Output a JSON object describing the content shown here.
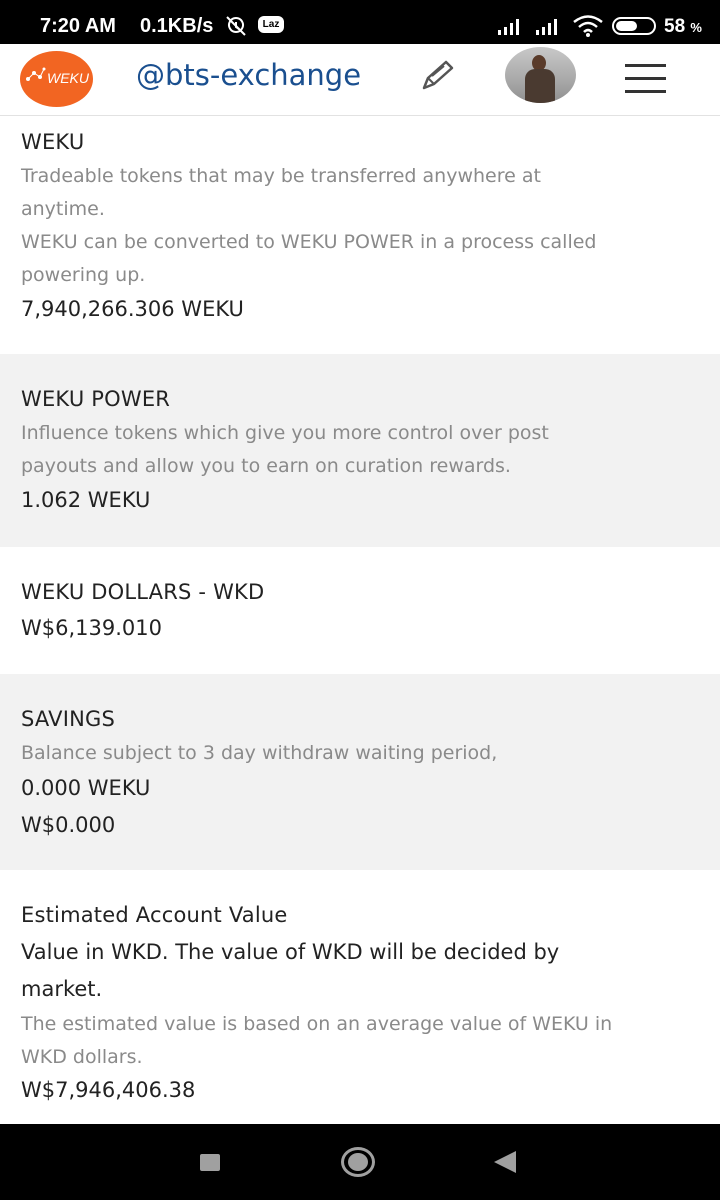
{
  "statusbar": {
    "time": "7:20 AM",
    "speed": "0.1KB/s",
    "app_badge": "Laz",
    "battery": "58",
    "battery_unit": "%",
    "battery_level_pct": 58
  },
  "header": {
    "logo_text": "WEKU",
    "username": "@bts-exchange"
  },
  "sections": [
    {
      "title": "WEKU",
      "description": [
        "Tradeable tokens that may be transferred anywhere at",
        "anytime.",
        "WEKU can be converted to WEKU POWER in a process called",
        "powering up."
      ],
      "value": "7,940,266.306 WEKU"
    },
    {
      "title": "WEKU POWER",
      "description": [
        "Influence tokens which give you more control over post",
        "payouts and allow you to earn on curation rewards."
      ],
      "value": "1.062 WEKU"
    },
    {
      "title": "WEKU DOLLARS - WKD",
      "value": "W$6,139.010"
    },
    {
      "title": "SAVINGS",
      "description": [
        "Balance subject to 3 day withdraw waiting period,"
      ],
      "value": "0.000 WEKU",
      "value2": "W$0.000"
    },
    {
      "title": "Estimated Account Value",
      "note": [
        "Value in WKD. The value of WKD will be decided by",
        "market."
      ],
      "description": [
        "The estimated value is based on an average value of WEKU in",
        "WKD dollars."
      ],
      "value": "W$7,946,406.38"
    }
  ],
  "colors": {
    "status_bar": "#000000",
    "logo": "#f26522",
    "username": "#1a4f8f",
    "grey_section": "#f2f2f2",
    "muted_text": "#8a8a8a"
  },
  "icons": [
    "alarm-off-icon",
    "signal-icon",
    "wifi-icon",
    "battery-icon",
    "edit-pen-icon",
    "hamburger-menu-icon",
    "nav-recents-icon",
    "nav-home-icon",
    "nav-back-icon"
  ]
}
